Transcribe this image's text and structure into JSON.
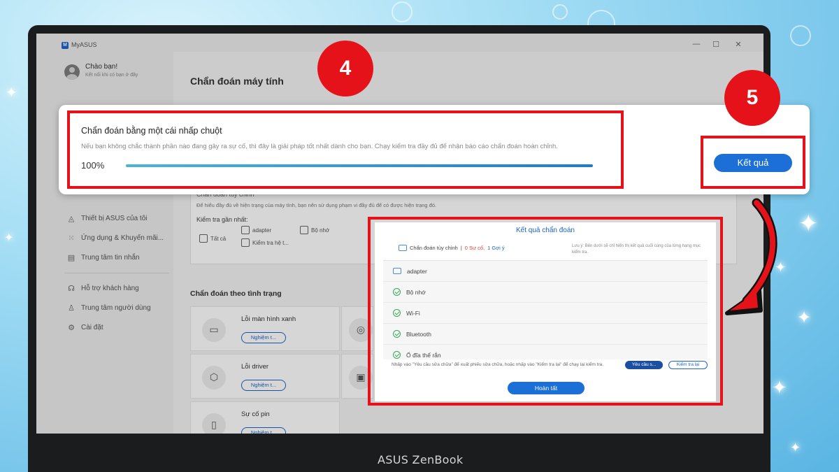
{
  "app": {
    "title": "MyASUS",
    "logo_text": "M",
    "window_controls": [
      "—",
      "☐",
      "✕"
    ]
  },
  "laptop_brand": "ASUS ZenBook",
  "sidebar": {
    "greeting": "Chào bạn!",
    "greeting_sub": "Kết nối khi có bạn ở đây",
    "items": [
      {
        "label": "Thiết bị ASUS của tôi",
        "icon": "device-icon"
      },
      {
        "label": "Ứng dụng & Khuyến mãi...",
        "icon": "apps-grid-icon"
      },
      {
        "label": "Trung tâm tin nhắn",
        "icon": "message-icon"
      },
      {
        "label": "Hỗ trợ khách hàng",
        "icon": "headset-icon"
      },
      {
        "label": "Trung tâm người dùng",
        "icon": "user-icon"
      },
      {
        "label": "Cài đặt",
        "icon": "gear-icon"
      }
    ]
  },
  "main": {
    "page_title": "Chẩn đoán máy tính",
    "custom_section": {
      "title": "Chẩn đoán tùy chỉnh",
      "description": "Để hiểu đầy đủ về hiện trạng của máy tính, bạn nên sử dụng phạm vi đầy đủ để có được hiện trạng đó.",
      "recent_label": "Kiểm tra gần nhất:",
      "checkboxes": [
        "Tất cả",
        "adapter",
        "Bộ nhớ",
        "Kiểm tra hệ t..."
      ]
    },
    "condition_title": "Chẩn đoán theo tình trạng",
    "conditions": [
      {
        "name": "Lỗi màn hình xanh",
        "button": "Nghiệm t...",
        "icon": "blue-screen-icon"
      },
      {
        "name": "Lỗi driver",
        "button": "Nghiệm t...",
        "icon": "driver-icon"
      },
      {
        "name": "Sự cố pin",
        "button": "Nghiệm t...",
        "icon": "battery-icon"
      }
    ]
  },
  "one_click": {
    "title": "Chẩn đoán bằng một cái nhấp chuột",
    "description": "Nếu bạn không chắc thành phần nào đang gây ra sự cố, thì đây là giải pháp tốt nhất dành cho bạn. Chạy kiểm tra đầy đủ để nhận báo cáo chẩn đoán hoàn chỉnh.",
    "progress_text": "100%",
    "progress": 1.0,
    "result_button": "Kết quả"
  },
  "results_dialog": {
    "title": "Kết quả chẩn đoán",
    "summary_label": "Chẩn đoán tùy chỉnh",
    "issues": "0 Sự cố,",
    "tips": "1 Gợi ý",
    "note": "Lưu ý: Bên dưới sẽ chỉ hiển thị kết quả cuối cùng của từng hạng mục kiểm tra.",
    "items": [
      {
        "label": "adapter",
        "status": "info"
      },
      {
        "label": "Bộ nhớ",
        "status": "ok"
      },
      {
        "label": "Wi-Fi",
        "status": "ok"
      },
      {
        "label": "Bluetooth",
        "status": "ok"
      },
      {
        "label": "Ổ đĩa thể rắn",
        "status": "ok"
      }
    ],
    "footer_text": "Nhấp vào \"Yêu cầu sửa chữa\" để xuất phiếu sửa chữa, hoặc nhấp vào \"Kiểm tra lại\" để chạy lại kiểm tra.",
    "repair_button": "Yêu cầu s...",
    "recheck_button": "Kiểm tra lại",
    "done_button": "Hoàn tất"
  },
  "annotations": {
    "step_4": "4",
    "step_5": "5",
    "color": "#e5121a"
  },
  "colors": {
    "accent": "#1c6fd6",
    "success": "#34a853",
    "background": "#7cc8ec"
  }
}
